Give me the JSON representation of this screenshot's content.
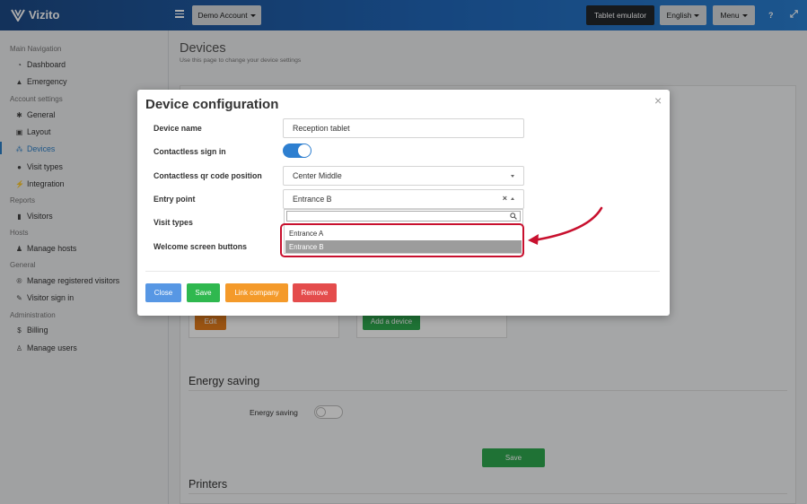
{
  "app": {
    "brand": "Vizito"
  },
  "header": {
    "account_label": "Demo Account",
    "tablet_label": "Tablet emulator",
    "language_label": "English",
    "menu_label": "Menu",
    "help_glyph": "?",
    "expand_glyph": "⤢"
  },
  "sidebar": {
    "sections": [
      {
        "title": "Main Navigation",
        "items": [
          {
            "label": "Dashboard",
            "icon": "dashboard-icon"
          },
          {
            "label": "Emergency",
            "icon": "warning-icon"
          }
        ]
      },
      {
        "title": "Account settings",
        "items": [
          {
            "label": "General",
            "icon": "gear-icon"
          },
          {
            "label": "Layout",
            "icon": "image-icon"
          },
          {
            "label": "Devices",
            "icon": "sitemap-icon",
            "active": true
          },
          {
            "label": "Visit types",
            "icon": "users-icon"
          },
          {
            "label": "Integration",
            "icon": "plug-icon"
          }
        ]
      },
      {
        "title": "Reports",
        "items": [
          {
            "label": "Visitors",
            "icon": "book-icon"
          }
        ]
      },
      {
        "title": "Hosts",
        "items": [
          {
            "label": "Manage hosts",
            "icon": "person-icon"
          }
        ]
      },
      {
        "title": "General",
        "items": [
          {
            "label": "Manage registered visitors",
            "icon": "registered-icon"
          },
          {
            "label": "Visitor sign in",
            "icon": "pencil-icon"
          }
        ]
      },
      {
        "title": "Administration",
        "items": [
          {
            "label": "Billing",
            "icon": "dollar-icon"
          },
          {
            "label": "Manage users",
            "icon": "user-plus-icon"
          }
        ]
      }
    ]
  },
  "page": {
    "title": "Devices",
    "subtitle": "Use this page to change your device settings",
    "edit_label": "Edit",
    "add_device_label": "Add a device",
    "energy_section": "Energy saving",
    "energy_label": "Energy saving",
    "energy_on": false,
    "save_label": "Save",
    "printers_section": "Printers"
  },
  "modal": {
    "title": "Device configuration",
    "close_glyph": "×",
    "fields": {
      "device_name": {
        "label": "Device name",
        "value": "Reception tablet"
      },
      "contactless": {
        "label": "Contactless sign in",
        "on": true
      },
      "qr_position": {
        "label": "Contactless qr code position",
        "value": "Center Middle"
      },
      "entry_point": {
        "label": "Entry point",
        "value": "Entrance B",
        "clear_glyph": "×"
      },
      "visit_types": {
        "label": "Visit types"
      },
      "welcome_buttons": {
        "label": "Welcome screen buttons"
      }
    },
    "dropdown": {
      "search_value": "",
      "options": [
        "Entrance A",
        "Entrance B"
      ],
      "selected_index": 1
    },
    "buttons": {
      "close": "Close",
      "save": "Save",
      "link_company": "Link company",
      "remove": "Remove"
    }
  },
  "colors": {
    "accent": "#2e7fd0",
    "highlight": "#c8102e",
    "close_btn": "#5797e4",
    "save_btn": "#2fb84f",
    "link_btn": "#f49a2a",
    "remove_btn": "#e44c4c"
  }
}
